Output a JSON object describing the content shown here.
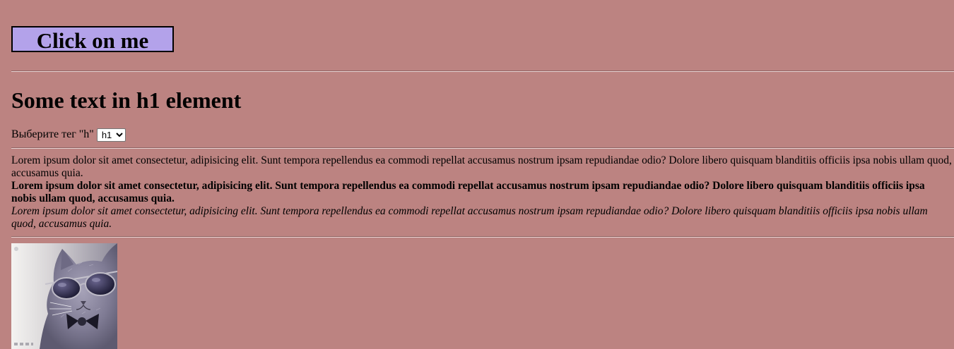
{
  "button": {
    "label": "Click on me"
  },
  "heading": {
    "text": "Some text in h1 element"
  },
  "tag_select": {
    "label": "Выберите тег \"h\"",
    "selected": "h1"
  },
  "paragraphs": {
    "normal": "Lorem ipsum dolor sit amet consectetur, adipisicing elit. Sunt tempora repellendus ea commodi repellat accusamus nostrum ipsam repudiandae odio? Dolore libero quisquam blanditiis officiis ipsa nobis ullam quod, accusamus quia.",
    "bold": "Lorem ipsum dolor sit amet consectetur, adipisicing elit. Sunt tempora repellendus ea commodi repellat accusamus nostrum ipsam repudiandae odio? Dolore libero quisquam blanditiis officiis ipsa nobis ullam quod, accusamus quia.",
    "italic": "Lorem ipsum dolor sit amet consectetur, adipisicing elit. Sunt tempora repellendus ea commodi repellat accusamus nostrum ipsam repudiandae odio? Dolore libero quisquam blanditiis officiis ipsa nobis ullam quod, accusamus quia."
  },
  "colors": {
    "background": "#bc8381",
    "button_bg": "#b3a2ea"
  }
}
